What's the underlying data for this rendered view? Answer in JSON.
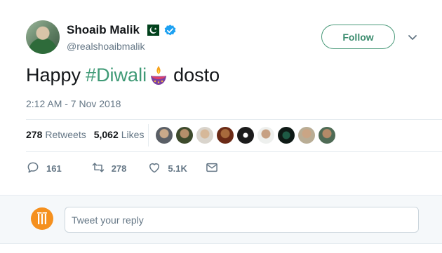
{
  "tweet": {
    "author": {
      "display_name": "Shoaib Malik",
      "handle": "@realshoaibmalik",
      "verified": true,
      "flag_icon": "pakistan-flag-icon"
    },
    "follow_label": "Follow",
    "text": {
      "prefix": "Happy",
      "hashtag": "#Diwali",
      "emoji": "diya-lamp-icon",
      "suffix": "dosto"
    },
    "timestamp": "2:12 AM - 7 Nov 2018",
    "stats": {
      "retweets_count": "278",
      "retweets_label": "Retweets",
      "likes_count": "5,062",
      "likes_label": "Likes"
    },
    "likers_visible": 9,
    "actions": {
      "reply_count": "161",
      "retweet_count": "278",
      "like_count": "5.1K"
    }
  },
  "reply": {
    "placeholder": "Tweet your reply"
  },
  "colors": {
    "accent": "#3f9a76",
    "verified": "#1da1f2",
    "muted": "#657786",
    "reply_avatar": "#f5901e"
  }
}
